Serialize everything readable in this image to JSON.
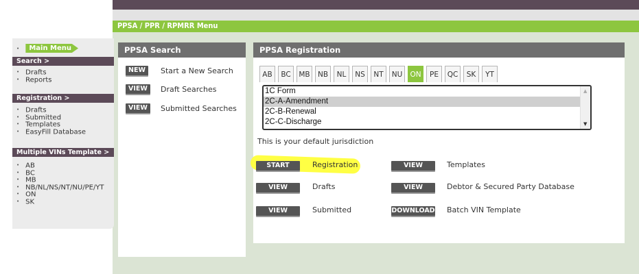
{
  "breadcrumb": "PPSA / PPR / RPMRR Menu",
  "sidebar": {
    "main_menu": "Main Menu",
    "search_head": "Search >",
    "search_items": [
      "Drafts",
      "Reports"
    ],
    "registration_head": "Registration >",
    "registration_items": [
      "Drafts",
      "Submitted",
      "Templates",
      "EasyFill Database"
    ],
    "vins_head": "Multiple VINs Template >",
    "vins_items": [
      "AB",
      "BC",
      "MB",
      "NB/NL/NS/NT/NU/PE/YT",
      "ON",
      "SK"
    ]
  },
  "ppsa_search": {
    "title": "PPSA Search",
    "rows": [
      {
        "button": "NEW",
        "label": "Start a New Search"
      },
      {
        "button": "VIEW",
        "label": "Draft Searches"
      },
      {
        "button": "VIEW",
        "label": "Submitted Searches"
      }
    ]
  },
  "ppsa_registration": {
    "title": "PPSA Registration",
    "tabs": [
      "AB",
      "BC",
      "MB",
      "NB",
      "NL",
      "NS",
      "NT",
      "NU",
      "ON",
      "PE",
      "QC",
      "SK",
      "YT"
    ],
    "active_tab": "ON",
    "forms": [
      "1C Form",
      "2C-A-Amendment",
      "2C-B-Renewal",
      "2C-C-Discharge"
    ],
    "selected_form": "2C-A-Amendment",
    "default_note": "This is your default jurisdiction",
    "actions_left": [
      {
        "button": "START",
        "label": "Registration"
      },
      {
        "button": "VIEW",
        "label": "Drafts"
      },
      {
        "button": "VIEW",
        "label": "Submitted"
      }
    ],
    "actions_right": [
      {
        "button": "VIEW",
        "label": "Templates"
      },
      {
        "button": "VIEW",
        "label": "Debtor & Secured Party Database"
      },
      {
        "button": "DOWNLOAD",
        "label": "Batch VIN Template"
      }
    ]
  },
  "colors": {
    "accent_green": "#8dc63f",
    "header_purple": "#5c4a58",
    "panel_head_gray": "#6f6f6f",
    "highlight_yellow": "#ffff3a"
  }
}
